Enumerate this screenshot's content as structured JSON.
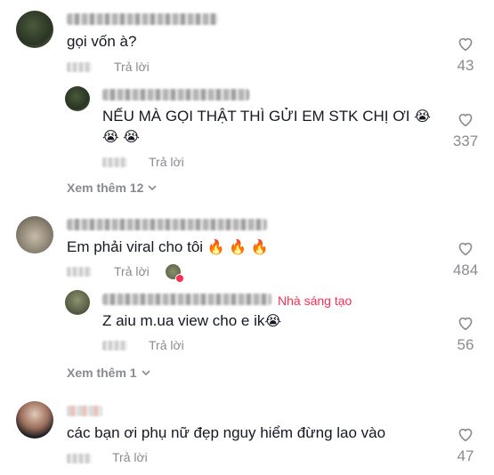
{
  "reply_label": "Trả lời",
  "comments": [
    {
      "text": "gọi vốn à?",
      "likes": "43"
    },
    {
      "text": "NẾU MÀ GỌI THẬT THÌ GỬI EM STK CHỊ ƠI",
      "emoji_line1": "😭",
      "emoji_line2": "😭 😭",
      "likes": "337"
    },
    {
      "text": "Em phải viral cho tôi",
      "emoji": "🔥 🔥 🔥",
      "likes": "484"
    },
    {
      "text": "Z aiu m.ua view cho e ik",
      "emoji": "😭",
      "likes": "56",
      "badge": "Nhà sáng tạo"
    },
    {
      "text": "các bạn ơi phụ nữ đẹp nguy hiểm đừng lao vào",
      "likes": "47"
    }
  ],
  "view_more": [
    "Xem thêm 12",
    "Xem thêm 1"
  ],
  "colors": {
    "accent": "#fe2c55",
    "muted": "#8a8b91"
  }
}
